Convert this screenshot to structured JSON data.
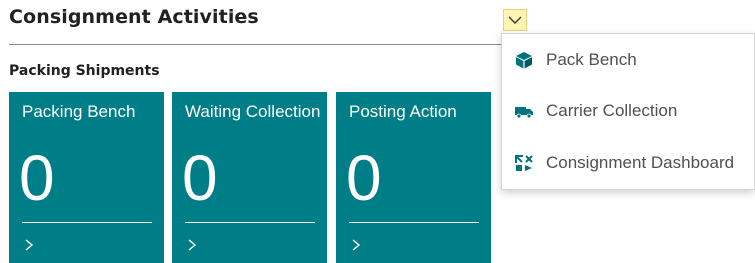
{
  "header": {
    "title": "Consignment Activities"
  },
  "section": {
    "title": "Packing Shipments"
  },
  "tiles": [
    {
      "label": "Packing Bench",
      "count": "0"
    },
    {
      "label": "Waiting Collection",
      "count": "0"
    },
    {
      "label": "Posting Action",
      "count": "0"
    }
  ],
  "menu": {
    "items": [
      {
        "label": "Pack Bench",
        "icon": "package-icon"
      },
      {
        "label": "Carrier Collection",
        "icon": "truck-icon"
      },
      {
        "label": "Consignment Dashboard",
        "icon": "dashboard-arrows-icon"
      }
    ]
  },
  "colors": {
    "tile_background": "#007e87",
    "icon_accent": "#00737c",
    "dropdown_highlight": "#fff4b3"
  }
}
